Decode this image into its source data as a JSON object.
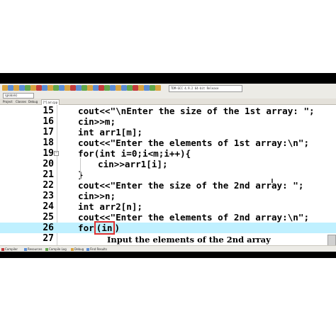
{
  "toolbar": {
    "compiler_select": "TDM-GCC 4.9.2 64-bit Release",
    "scope_select": "(globals)",
    "icon_colors": [
      "#d9a441",
      "#5b8dd6",
      "#d9a441",
      "#5b8dd6",
      "#62a84b",
      "#d9a441",
      "#c43c3c",
      "#5b8dd6",
      "#d9a441",
      "#62a84b",
      "#5b8dd6",
      "#d9a441",
      "#c43c3c",
      "#5b8dd6",
      "#62a84b",
      "#d9a441",
      "#5b8dd6",
      "#c43c3c",
      "#62a84b",
      "#5b8dd6",
      "#d9a441",
      "#5b8dd6",
      "#62a84b",
      "#c43c3c",
      "#d9a441",
      "#5b8dd6",
      "#62a84b",
      "#d9a441"
    ]
  },
  "side_tabs": [
    "Project",
    "Classes",
    "Debug"
  ],
  "file_tab": "[*] arr.cpp",
  "lines": [
    {
      "num": "15",
      "code": "cout<<\"\\nEnter the size of the 1st array: \";"
    },
    {
      "num": "16",
      "code": "cin>>m;"
    },
    {
      "num": "17",
      "code": "int arr1[m];"
    },
    {
      "num": "18",
      "code": "cout<<\"Enter the elements of 1st array:\\n\";"
    },
    {
      "num": "19",
      "code": "for(int i=0;i<m;i++){"
    },
    {
      "num": "20",
      "code": "cin>>arr1[i];"
    },
    {
      "num": "21",
      "code": "}"
    },
    {
      "num": "22",
      "code": "cout<<\"Enter the size of the 2nd array: \";"
    },
    {
      "num": "23",
      "code": "cin>>n;"
    },
    {
      "num": "24",
      "code": "int arr2[n];"
    },
    {
      "num": "25",
      "code": "cout<<\"Enter the elements of 2nd array:\\n\";"
    },
    {
      "num": "26",
      "code_pre": "for",
      "code_boxed": "(in",
      "code_post": ")"
    },
    {
      "num": "27",
      "code": ""
    }
  ],
  "subtitle": "Input the elements of the 2nd array",
  "status_tabs": [
    "Compiler",
    "Resources",
    "Compile Log",
    "Debug",
    "Find Results"
  ],
  "status_icon_colors": [
    "#c43c3c",
    "#5b8dd6",
    "#62a84b",
    "#d9a441",
    "#5b8dd6"
  ],
  "highlight_color": "#bff0ff"
}
